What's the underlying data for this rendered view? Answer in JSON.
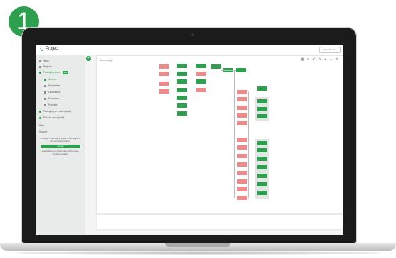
{
  "badge": "1",
  "app": {
    "logo": "↘",
    "title": "Project",
    "user_menu": "Nomi Pouzet"
  },
  "sidebar": {
    "items": [
      {
        "label": "Inbox"
      },
      {
        "label": "Projects"
      },
      {
        "label": "Packaging demo",
        "tag": "Edit"
      },
      {
        "label": "Canvas"
      },
      {
        "label": "Parameters"
      },
      {
        "label": "Calculations"
      },
      {
        "label": "Processes"
      },
      {
        "label": "Products"
      },
      {
        "label": "Packaging and demo (draft)"
      },
      {
        "label": "Product demo (draft)"
      },
      {
        "label": "Data"
      },
      {
        "label": "Support"
      }
    ],
    "help_text": "To export or file drag & drop it in the project or the workspace below.",
    "action_button": "Export",
    "footer_text": "New features on Project are coming soon. Contact our team."
  },
  "canvas": {
    "caption": "Demo design",
    "toolbar_icons": [
      "grid-icon",
      "list-icon",
      "undo-icon",
      "redo-icon",
      "zoom-in-icon",
      "zoom-out-icon",
      "settings-icon"
    ]
  },
  "colors": {
    "accent": "#2e9e4f",
    "node_red": "#ef8a8a",
    "node_green": "#2e9e4f"
  }
}
